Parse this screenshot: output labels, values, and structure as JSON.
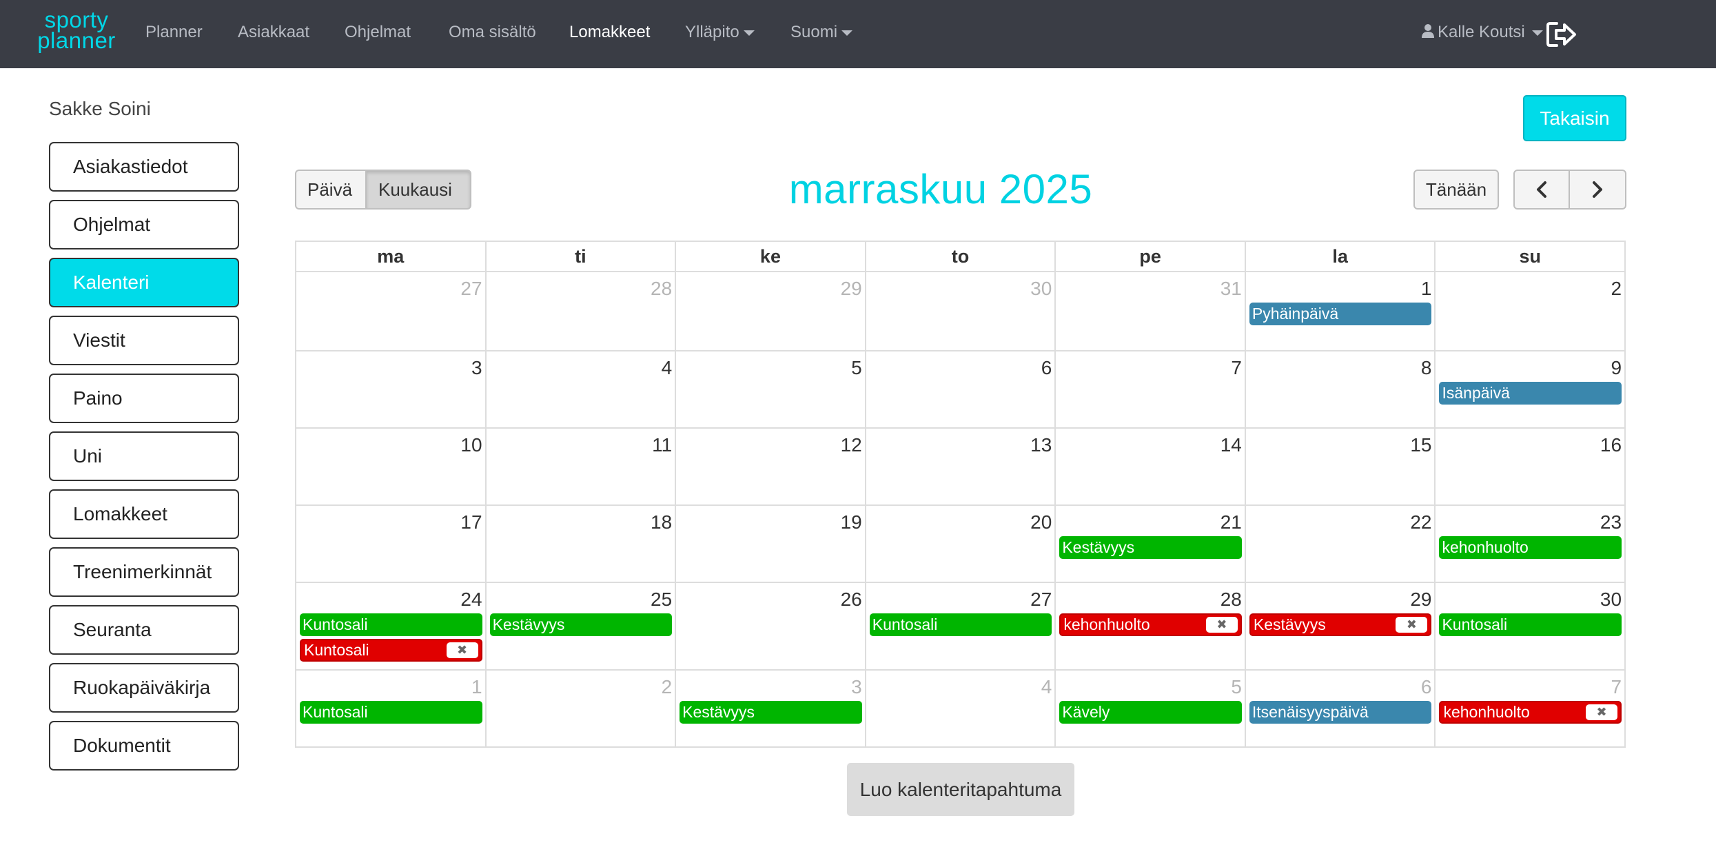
{
  "navbar": {
    "logo_line1": "sporty",
    "logo_line2": "planner",
    "items": [
      {
        "label": "Planner"
      },
      {
        "label": "Asiakkaat"
      },
      {
        "label": "Ohjelmat"
      },
      {
        "label": "Oma sisältö"
      },
      {
        "label": "Lomakkeet",
        "active": true
      },
      {
        "label": "Ylläpito",
        "dropdown": true
      },
      {
        "label": "Suomi",
        "dropdown": true
      }
    ],
    "user": "Kalle Koutsi"
  },
  "sidebar": {
    "client_name": "Sakke Soini",
    "items": [
      {
        "label": "Asiakastiedot"
      },
      {
        "label": "Ohjelmat"
      },
      {
        "label": "Kalenteri",
        "active": true
      },
      {
        "label": "Viestit"
      },
      {
        "label": "Paino"
      },
      {
        "label": "Uni"
      },
      {
        "label": "Lomakkeet"
      },
      {
        "label": "Treenimerkinnät"
      },
      {
        "label": "Seuranta"
      },
      {
        "label": "Ruokapäiväkirja"
      },
      {
        "label": "Dokumentit"
      }
    ]
  },
  "toolbar": {
    "back_label": "Takaisin",
    "view_day": "Päivä",
    "view_month": "Kuukausi",
    "today_label": "Tänään"
  },
  "calendar": {
    "title": "marraskuu 2025",
    "weekdays": [
      "ma",
      "ti",
      "ke",
      "to",
      "pe",
      "la",
      "su"
    ],
    "weeks": [
      [
        {
          "day": "27",
          "other": true,
          "events": []
        },
        {
          "day": "28",
          "other": true,
          "events": []
        },
        {
          "day": "29",
          "other": true,
          "events": []
        },
        {
          "day": "30",
          "other": true,
          "events": []
        },
        {
          "day": "31",
          "other": true,
          "events": []
        },
        {
          "day": "1",
          "events": [
            {
              "title": "Pyhäinpäivä",
              "color": "blue"
            }
          ]
        },
        {
          "day": "2",
          "events": []
        }
      ],
      [
        {
          "day": "3",
          "events": []
        },
        {
          "day": "4",
          "events": []
        },
        {
          "day": "5",
          "events": []
        },
        {
          "day": "6",
          "events": []
        },
        {
          "day": "7",
          "events": []
        },
        {
          "day": "8",
          "events": []
        },
        {
          "day": "9",
          "events": [
            {
              "title": "Isänpäivä",
              "color": "blue"
            }
          ]
        }
      ],
      [
        {
          "day": "10",
          "events": []
        },
        {
          "day": "11",
          "events": []
        },
        {
          "day": "12",
          "events": []
        },
        {
          "day": "13",
          "events": []
        },
        {
          "day": "14",
          "events": []
        },
        {
          "day": "15",
          "events": []
        },
        {
          "day": "16",
          "events": []
        }
      ],
      [
        {
          "day": "17",
          "events": []
        },
        {
          "day": "18",
          "events": []
        },
        {
          "day": "19",
          "events": []
        },
        {
          "day": "20",
          "events": []
        },
        {
          "day": "21",
          "events": [
            {
              "title": "Kestävyys",
              "color": "green"
            }
          ]
        },
        {
          "day": "22",
          "events": []
        },
        {
          "day": "23",
          "events": [
            {
              "title": "kehonhuolto",
              "color": "green"
            }
          ]
        }
      ],
      [
        {
          "day": "24",
          "events": [
            {
              "title": "Kuntosali",
              "color": "green"
            },
            {
              "title": "Kuntosali",
              "color": "red",
              "removable": true
            }
          ]
        },
        {
          "day": "25",
          "events": [
            {
              "title": "Kestävyys",
              "color": "green"
            }
          ]
        },
        {
          "day": "26",
          "events": []
        },
        {
          "day": "27",
          "events": [
            {
              "title": "Kuntosali",
              "color": "green"
            }
          ]
        },
        {
          "day": "28",
          "events": [
            {
              "title": "kehonhuolto",
              "color": "red",
              "removable": true
            }
          ]
        },
        {
          "day": "29",
          "events": [
            {
              "title": "Kestävyys",
              "color": "red",
              "removable": true
            }
          ]
        },
        {
          "day": "30",
          "events": [
            {
              "title": "Kuntosali",
              "color": "green"
            }
          ]
        }
      ],
      [
        {
          "day": "1",
          "other": true,
          "events": [
            {
              "title": "Kuntosali",
              "color": "green"
            }
          ]
        },
        {
          "day": "2",
          "other": true,
          "events": []
        },
        {
          "day": "3",
          "other": true,
          "events": [
            {
              "title": "Kestävyys",
              "color": "green"
            }
          ]
        },
        {
          "day": "4",
          "other": true,
          "events": []
        },
        {
          "day": "5",
          "other": true,
          "events": [
            {
              "title": "Kävely",
              "color": "green"
            }
          ]
        },
        {
          "day": "6",
          "other": true,
          "events": [
            {
              "title": "Itsenäisyyspäivä",
              "color": "blue"
            }
          ]
        },
        {
          "day": "7",
          "other": true,
          "events": [
            {
              "title": "kehonhuolto",
              "color": "red",
              "removable": true
            }
          ]
        }
      ]
    ],
    "remove_glyph": "✖"
  },
  "create_event_label": "Luo kalenteritapahtuma",
  "colors": {
    "accent": "#00dbe9",
    "navbar_bg": "#3a3d45",
    "event_green": "#00b500",
    "event_red": "#e00000",
    "event_blue": "#3a87ad"
  }
}
